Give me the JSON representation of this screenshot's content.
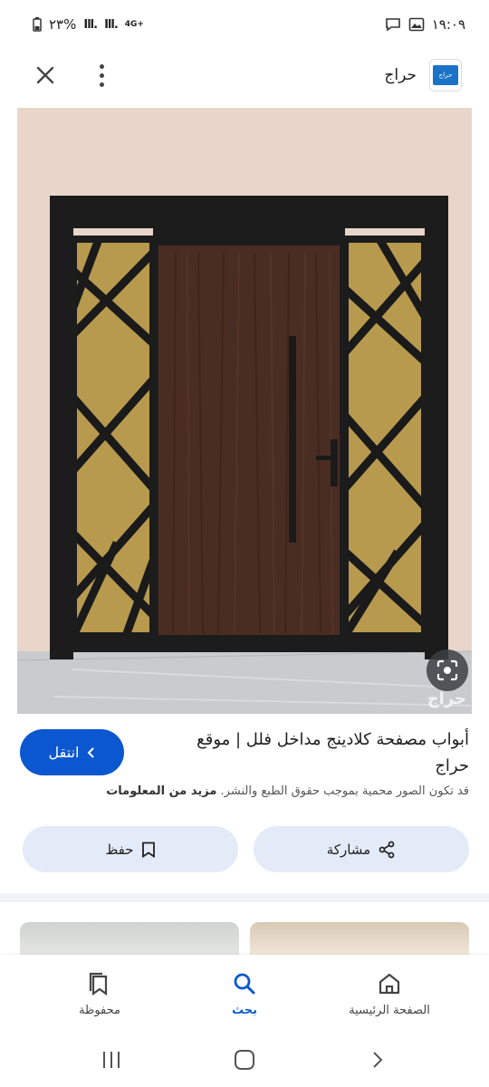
{
  "status_bar": {
    "battery": "٢٣%",
    "network": "4G+",
    "time": "١٩:٠٩"
  },
  "top_bar": {
    "site_name": "حراج",
    "logo_text": "حراج"
  },
  "image": {
    "watermark": "حراج"
  },
  "info": {
    "visit_label": "انتقل",
    "title": "أبواب مصفحة كلادينج مداخل فلل | موقع حراج",
    "copyright": "قد تكون الصور محمية بموجب حقوق الطبع والنشر.",
    "more_info": "مزيد من المعلومات"
  },
  "actions": {
    "share_label": "مشاركة",
    "save_label": "حفظ"
  },
  "bottom_nav": {
    "home_label": "الصفحة الرئيسية",
    "search_label": "بحث",
    "saved_label": "محفوظة"
  },
  "colors": {
    "accent": "#0b57d0",
    "action_bg": "#e3ebf8"
  }
}
